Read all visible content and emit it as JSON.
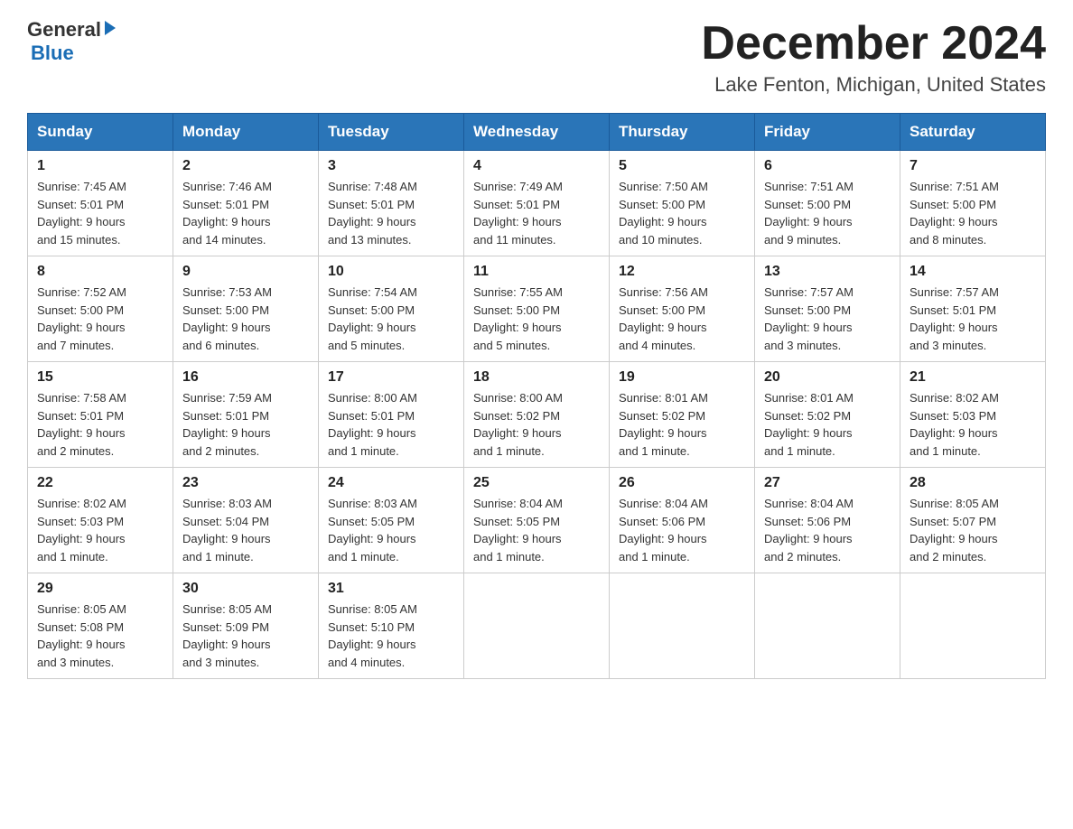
{
  "header": {
    "logo_general": "General",
    "logo_blue": "Blue",
    "month_title": "December 2024",
    "location": "Lake Fenton, Michigan, United States"
  },
  "days_of_week": [
    "Sunday",
    "Monday",
    "Tuesday",
    "Wednesday",
    "Thursday",
    "Friday",
    "Saturday"
  ],
  "weeks": [
    [
      {
        "day": "1",
        "sunrise": "7:45 AM",
        "sunset": "5:01 PM",
        "daylight": "9 hours and 15 minutes."
      },
      {
        "day": "2",
        "sunrise": "7:46 AM",
        "sunset": "5:01 PM",
        "daylight": "9 hours and 14 minutes."
      },
      {
        "day": "3",
        "sunrise": "7:48 AM",
        "sunset": "5:01 PM",
        "daylight": "9 hours and 13 minutes."
      },
      {
        "day": "4",
        "sunrise": "7:49 AM",
        "sunset": "5:01 PM",
        "daylight": "9 hours and 11 minutes."
      },
      {
        "day": "5",
        "sunrise": "7:50 AM",
        "sunset": "5:00 PM",
        "daylight": "9 hours and 10 minutes."
      },
      {
        "day": "6",
        "sunrise": "7:51 AM",
        "sunset": "5:00 PM",
        "daylight": "9 hours and 9 minutes."
      },
      {
        "day": "7",
        "sunrise": "7:51 AM",
        "sunset": "5:00 PM",
        "daylight": "9 hours and 8 minutes."
      }
    ],
    [
      {
        "day": "8",
        "sunrise": "7:52 AM",
        "sunset": "5:00 PM",
        "daylight": "9 hours and 7 minutes."
      },
      {
        "day": "9",
        "sunrise": "7:53 AM",
        "sunset": "5:00 PM",
        "daylight": "9 hours and 6 minutes."
      },
      {
        "day": "10",
        "sunrise": "7:54 AM",
        "sunset": "5:00 PM",
        "daylight": "9 hours and 5 minutes."
      },
      {
        "day": "11",
        "sunrise": "7:55 AM",
        "sunset": "5:00 PM",
        "daylight": "9 hours and 5 minutes."
      },
      {
        "day": "12",
        "sunrise": "7:56 AM",
        "sunset": "5:00 PM",
        "daylight": "9 hours and 4 minutes."
      },
      {
        "day": "13",
        "sunrise": "7:57 AM",
        "sunset": "5:00 PM",
        "daylight": "9 hours and 3 minutes."
      },
      {
        "day": "14",
        "sunrise": "7:57 AM",
        "sunset": "5:01 PM",
        "daylight": "9 hours and 3 minutes."
      }
    ],
    [
      {
        "day": "15",
        "sunrise": "7:58 AM",
        "sunset": "5:01 PM",
        "daylight": "9 hours and 2 minutes."
      },
      {
        "day": "16",
        "sunrise": "7:59 AM",
        "sunset": "5:01 PM",
        "daylight": "9 hours and 2 minutes."
      },
      {
        "day": "17",
        "sunrise": "8:00 AM",
        "sunset": "5:01 PM",
        "daylight": "9 hours and 1 minute."
      },
      {
        "day": "18",
        "sunrise": "8:00 AM",
        "sunset": "5:02 PM",
        "daylight": "9 hours and 1 minute."
      },
      {
        "day": "19",
        "sunrise": "8:01 AM",
        "sunset": "5:02 PM",
        "daylight": "9 hours and 1 minute."
      },
      {
        "day": "20",
        "sunrise": "8:01 AM",
        "sunset": "5:02 PM",
        "daylight": "9 hours and 1 minute."
      },
      {
        "day": "21",
        "sunrise": "8:02 AM",
        "sunset": "5:03 PM",
        "daylight": "9 hours and 1 minute."
      }
    ],
    [
      {
        "day": "22",
        "sunrise": "8:02 AM",
        "sunset": "5:03 PM",
        "daylight": "9 hours and 1 minute."
      },
      {
        "day": "23",
        "sunrise": "8:03 AM",
        "sunset": "5:04 PM",
        "daylight": "9 hours and 1 minute."
      },
      {
        "day": "24",
        "sunrise": "8:03 AM",
        "sunset": "5:05 PM",
        "daylight": "9 hours and 1 minute."
      },
      {
        "day": "25",
        "sunrise": "8:04 AM",
        "sunset": "5:05 PM",
        "daylight": "9 hours and 1 minute."
      },
      {
        "day": "26",
        "sunrise": "8:04 AM",
        "sunset": "5:06 PM",
        "daylight": "9 hours and 1 minute."
      },
      {
        "day": "27",
        "sunrise": "8:04 AM",
        "sunset": "5:06 PM",
        "daylight": "9 hours and 2 minutes."
      },
      {
        "day": "28",
        "sunrise": "8:05 AM",
        "sunset": "5:07 PM",
        "daylight": "9 hours and 2 minutes."
      }
    ],
    [
      {
        "day": "29",
        "sunrise": "8:05 AM",
        "sunset": "5:08 PM",
        "daylight": "9 hours and 3 minutes."
      },
      {
        "day": "30",
        "sunrise": "8:05 AM",
        "sunset": "5:09 PM",
        "daylight": "9 hours and 3 minutes."
      },
      {
        "day": "31",
        "sunrise": "8:05 AM",
        "sunset": "5:10 PM",
        "daylight": "9 hours and 4 minutes."
      },
      null,
      null,
      null,
      null
    ]
  ]
}
